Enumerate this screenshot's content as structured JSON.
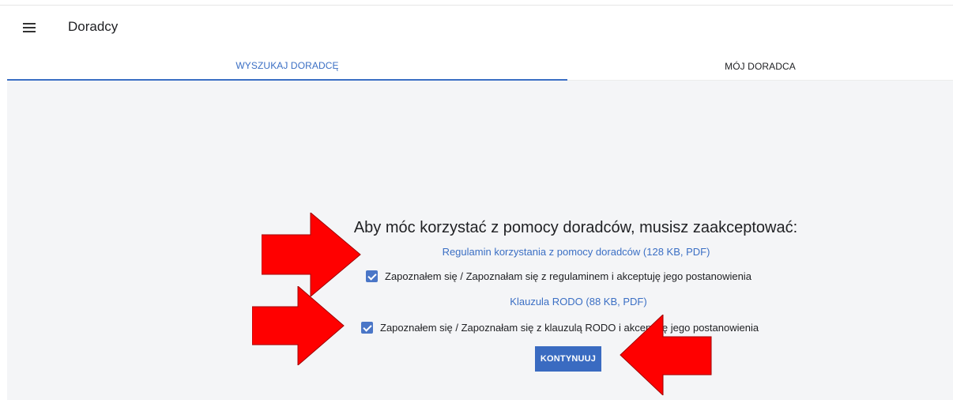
{
  "header": {
    "title": "Doradcy"
  },
  "tabs": [
    {
      "label": "WYSZUKAJ DORADCĘ",
      "active": true
    },
    {
      "label": "MÓJ DORADCA",
      "active": false
    }
  ],
  "consent": {
    "heading": "Aby móc korzystać z pomocy doradców, musisz zaakceptować:",
    "regulations_link": "Regulamin korzystania z pomocy doradców (128 KB, PDF)",
    "regulations_checkbox_label": "Zapoznałem się / Zapoznałam się z regulaminem i akceptuję jego postanowienia",
    "regulations_checked": true,
    "rodo_link": "Klauzula RODO (88 KB, PDF)",
    "rodo_checkbox_label": "Zapoznałem się / Zapoznałam się z klauzulą RODO i akceptuję jego postanowienia",
    "rodo_checked": true,
    "continue_button": "KONTYNUUJ"
  },
  "colors": {
    "accent": "#3b6fc4",
    "button": "#3a6bc1",
    "background": "#f4f5f7",
    "annotation_arrow": "#ff0000"
  },
  "icons": [
    "menu-icon",
    "checkbox-checked-icon",
    "annotation-arrow"
  ]
}
